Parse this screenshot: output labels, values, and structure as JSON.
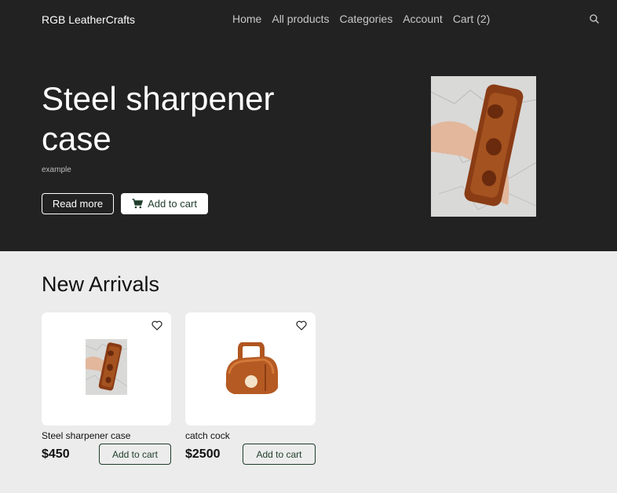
{
  "nav": {
    "brand": "RGB LeatherCrafts",
    "links": [
      "Home",
      "All products",
      "Categories",
      "Account",
      "Cart (2)"
    ],
    "search_icon": "search-icon"
  },
  "hero": {
    "title": "Steel sharpener case",
    "subtitle": "example",
    "read_more": "Read more",
    "add_to_cart": "Add to cart",
    "cart_icon": "shopping-cart-icon"
  },
  "section": {
    "title": "New Arrivals"
  },
  "products": [
    {
      "name": "Steel sharpener case",
      "price": "$450",
      "button": "Add to cart",
      "icon": "heart-icon"
    },
    {
      "name": "catch cock",
      "price": "$2500",
      "button": "Add to cart",
      "icon": "heart-icon"
    }
  ],
  "colors": {
    "hero_bg": "#222222",
    "page_bg": "#ececec",
    "accent_green": "#1f3d2b"
  }
}
